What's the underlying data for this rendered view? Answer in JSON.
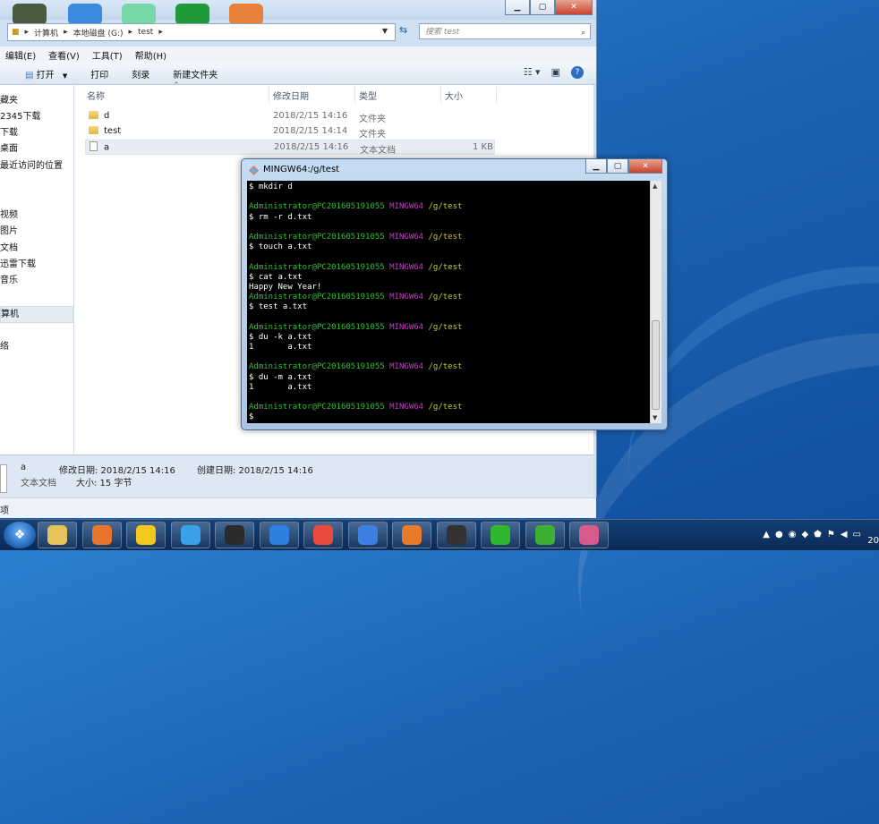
{
  "explorer": {
    "breadcrumb": [
      "计算机",
      "本地磁盘 (G:)",
      "test"
    ],
    "search_placeholder": "搜索 test",
    "menu": [
      "编辑(E)",
      "查看(V)",
      "工具(T)",
      "帮助(H)"
    ],
    "toolbar": [
      "打开",
      "打印",
      "刻录",
      "新建文件夹"
    ],
    "nav": [
      "藏夹",
      "2345下载",
      "下载",
      "桌面",
      "最近访问的位置",
      "视频",
      "图片",
      "文档",
      "迅雷下载",
      "音乐",
      "算机",
      "络"
    ],
    "columns": [
      "名称",
      "修改日期",
      "类型",
      "大小"
    ],
    "files": [
      {
        "name": "d",
        "date": "2018/2/15 14:16",
        "type": "文件夹",
        "size": "",
        "icon": "folder-icon"
      },
      {
        "name": "test",
        "date": "2018/2/15 14:14",
        "type": "文件夹",
        "size": "",
        "icon": "folder-icon"
      },
      {
        "name": "a",
        "date": "2018/2/15 14:16",
        "type": "文本文档",
        "size": "1 KB",
        "icon": "file-icon"
      }
    ],
    "details": {
      "name": "a",
      "type": "文本文档",
      "modified": "修改日期: 2018/2/15 14:16",
      "created": "创建日期: 2018/2/15 14:16",
      "size": "大小: 15 字节"
    },
    "status": "项"
  },
  "terminal": {
    "title": "MINGW64:/g/test",
    "user": "Administrator@PC201605191055",
    "env": "MINGW64",
    "path": "/g/test",
    "lines": [
      {
        "kind": "cmd",
        "text": "$ mkdir d"
      },
      {
        "kind": "blank",
        "text": ""
      },
      {
        "kind": "prompt",
        "text": ""
      },
      {
        "kind": "cmd",
        "text": "$ rm -r d.txt"
      },
      {
        "kind": "blank",
        "text": ""
      },
      {
        "kind": "prompt",
        "text": ""
      },
      {
        "kind": "cmd",
        "text": "$ touch a.txt"
      },
      {
        "kind": "blank",
        "text": ""
      },
      {
        "kind": "prompt",
        "text": ""
      },
      {
        "kind": "cmd",
        "text": "$ cat a.txt"
      },
      {
        "kind": "out",
        "text": "Happy New Year!"
      },
      {
        "kind": "prompt",
        "text": ""
      },
      {
        "kind": "cmd",
        "text": "$ test a.txt"
      },
      {
        "kind": "blank",
        "text": ""
      },
      {
        "kind": "prompt",
        "text": ""
      },
      {
        "kind": "cmd",
        "text": "$ du -k a.txt"
      },
      {
        "kind": "out",
        "text": "1       a.txt"
      },
      {
        "kind": "blank",
        "text": ""
      },
      {
        "kind": "prompt",
        "text": ""
      },
      {
        "kind": "cmd",
        "text": "$ du -m a.txt"
      },
      {
        "kind": "out",
        "text": "1       a.txt"
      },
      {
        "kind": "blank",
        "text": ""
      },
      {
        "kind": "prompt",
        "text": ""
      },
      {
        "kind": "cmd",
        "text": "$"
      }
    ]
  },
  "taskbar": {
    "apps": [
      {
        "name": "file-explorer",
        "color": "#e6c35a"
      },
      {
        "name": "media-player",
        "color": "#e8742c"
      },
      {
        "name": "360-browser",
        "color": "#f2c81d"
      },
      {
        "name": "ie-browser",
        "color": "#3aa0e8"
      },
      {
        "name": "git-app",
        "color": "#2b2b2b"
      },
      {
        "name": "feishu-app",
        "color": "#2f7fe0"
      },
      {
        "name": "chrome-browser",
        "color": "#e84a3c"
      },
      {
        "name": "baidu-app",
        "color": "#3d7fe0"
      },
      {
        "name": "firefox-browser",
        "color": "#e87a2c"
      },
      {
        "name": "obs-app",
        "color": "#333333"
      },
      {
        "name": "green-app",
        "color": "#2fb82f"
      },
      {
        "name": "wechat-app",
        "color": "#3cb034"
      },
      {
        "name": "git-gui-app",
        "color": "#d85a8c"
      }
    ],
    "clock": "20"
  }
}
